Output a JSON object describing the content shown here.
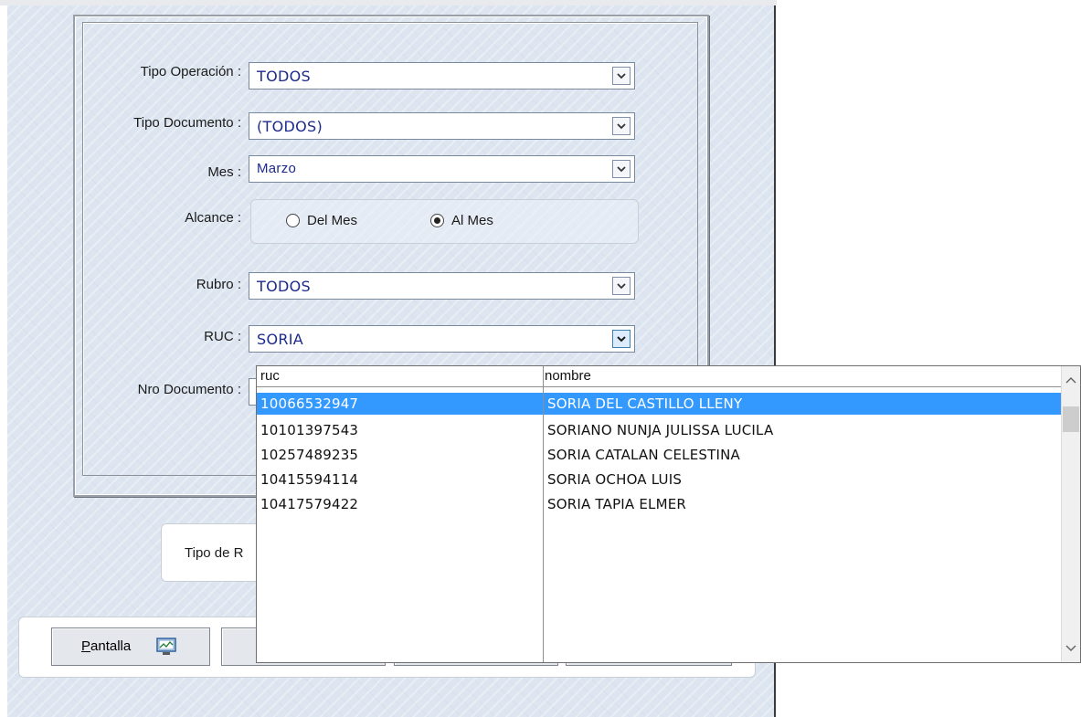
{
  "form": {
    "tipo_operacion": {
      "label": "Tipo Operación :",
      "value": "TODOS"
    },
    "tipo_documento": {
      "label": "Tipo Documento :",
      "value": "(TODOS)"
    },
    "mes": {
      "label": "Mes :",
      "value": "Marzo"
    },
    "alcance": {
      "label": "Alcance :",
      "options": [
        {
          "label": "Del Mes",
          "selected": false
        },
        {
          "label": "Al Mes",
          "selected": true
        }
      ]
    },
    "rubro": {
      "label": "Rubro :",
      "value": "TODOS"
    },
    "ruc": {
      "label": "RUC :",
      "value": "SORIA"
    },
    "nro_documento": {
      "label": "Nro Documento :"
    },
    "tipo_reporte_label": "Tipo de R"
  },
  "buttons": {
    "pantalla": {
      "label_underlined": "P",
      "label_rest": "antalla",
      "icon": "screen-report-icon"
    }
  },
  "dropdown": {
    "headers": {
      "ruc": "ruc",
      "nombre": "nombre"
    },
    "rows": [
      {
        "ruc": "10066532947",
        "nombre": "SORIA DEL CASTILLO LLENY",
        "selected": true
      },
      {
        "ruc": "10101397543",
        "nombre": "SORIANO NUNJA JULISSA LUCILA",
        "selected": false
      },
      {
        "ruc": "10257489235",
        "nombre": "SORIA CATALAN CELESTINA",
        "selected": false
      },
      {
        "ruc": "10415594114",
        "nombre": "SORIA OCHOA LUIS",
        "selected": false
      },
      {
        "ruc": "10417579422",
        "nombre": "SORIA TAPIA ELMER",
        "selected": false
      }
    ]
  },
  "colors": {
    "selection": "#3399ff",
    "combo_text": "#1c2a8c",
    "form_background": "#dde5f0"
  }
}
